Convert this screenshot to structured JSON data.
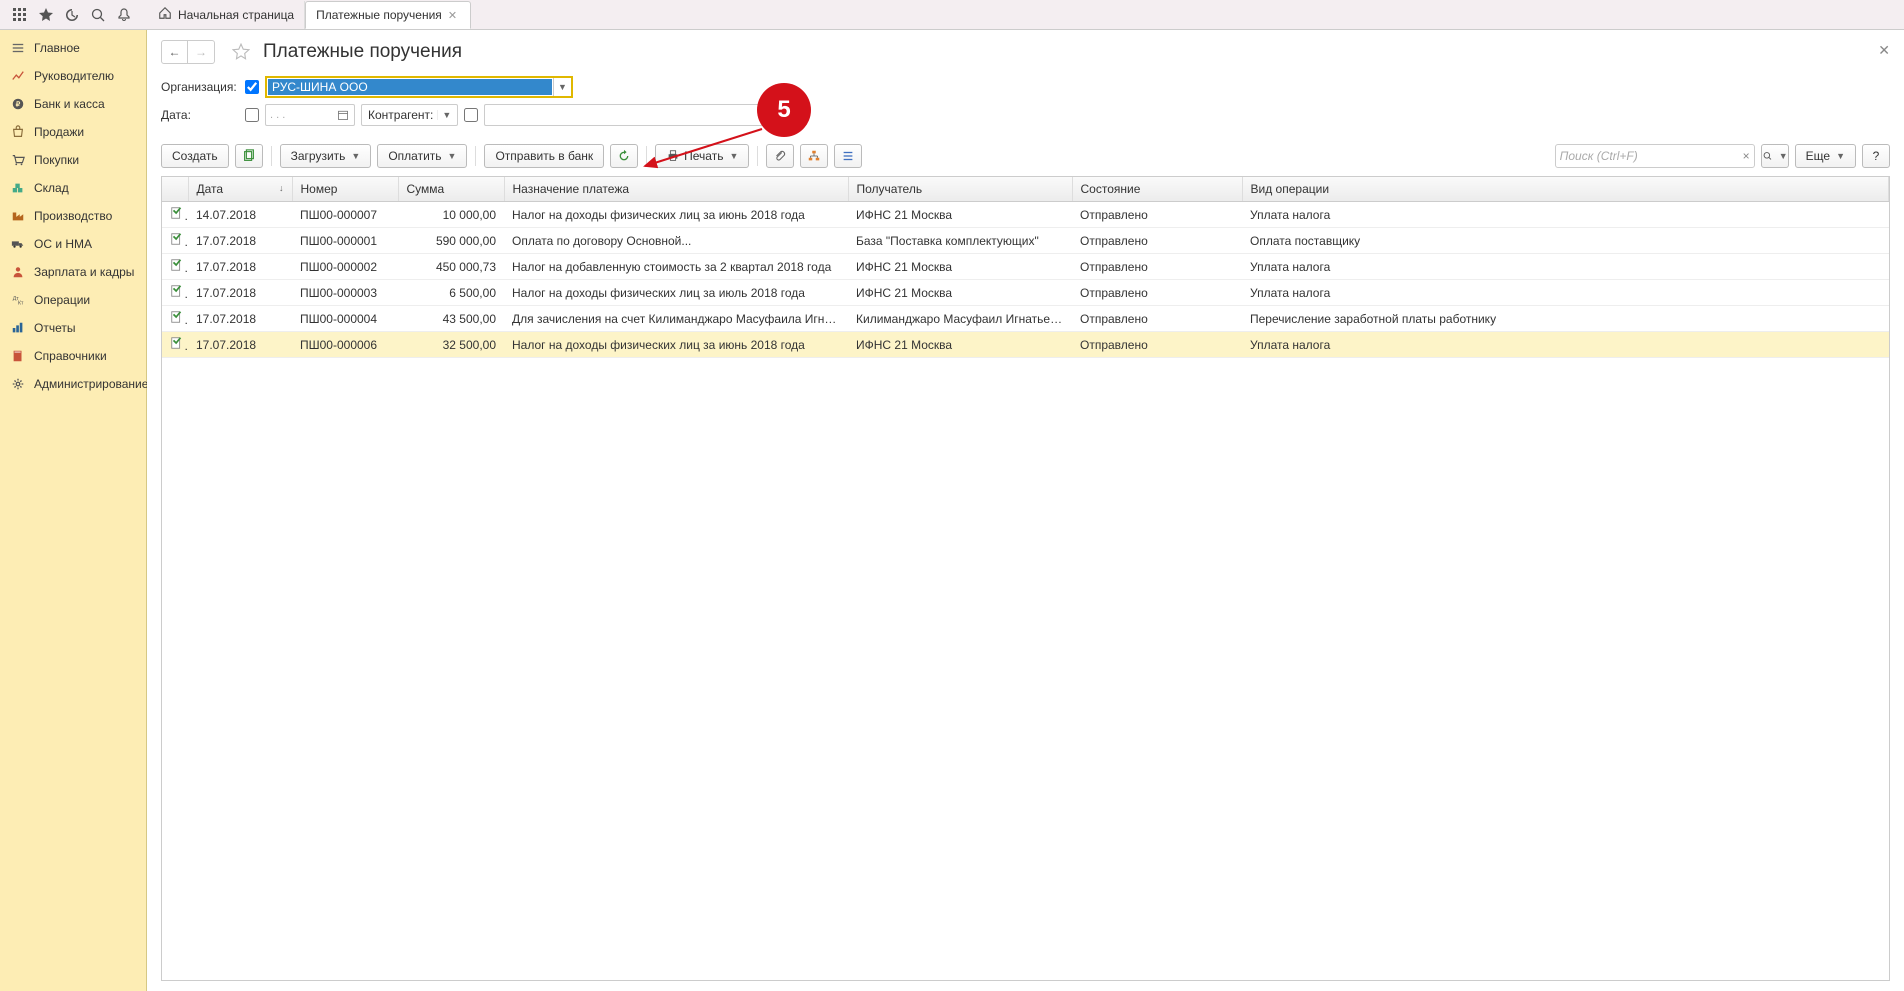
{
  "tabs": {
    "home": "Начальная страница",
    "active": "Платежные поручения"
  },
  "sidebar": {
    "items": [
      {
        "label": "Главное"
      },
      {
        "label": "Руководителю"
      },
      {
        "label": "Банк и касса"
      },
      {
        "label": "Продажи"
      },
      {
        "label": "Покупки"
      },
      {
        "label": "Склад"
      },
      {
        "label": "Производство"
      },
      {
        "label": "ОС и НМА"
      },
      {
        "label": "Зарплата и кадры"
      },
      {
        "label": "Операции"
      },
      {
        "label": "Отчеты"
      },
      {
        "label": "Справочники"
      },
      {
        "label": "Администрирование"
      }
    ]
  },
  "page": {
    "title": "Платежные поручения"
  },
  "filters": {
    "org_label": "Организация:",
    "org_value": "РУС-ШИНА ООО",
    "date_label": "Дата:",
    "date_placeholder": ". .   .",
    "kontragent_label": "Контрагент:"
  },
  "toolbar": {
    "create": "Создать",
    "load": "Загрузить",
    "pay": "Оплатить",
    "send_bank": "Отправить в банк",
    "print": "Печать",
    "search_placeholder": "Поиск (Ctrl+F)",
    "more": "Еще"
  },
  "table": {
    "headers": {
      "date": "Дата",
      "number": "Номер",
      "amount": "Сумма",
      "purpose": "Назначение платежа",
      "recipient": "Получатель",
      "state": "Состояние",
      "type": "Вид операции"
    },
    "rows": [
      {
        "date": "14.07.2018",
        "number": "ПШ00-000007",
        "amount": "10 000,00",
        "purpose": "Налог на доходы физических лиц за июнь 2018 года",
        "recipient": "ИФНС 21 Москва",
        "state": "Отправлено",
        "type": "Уплата налога"
      },
      {
        "date": "17.07.2018",
        "number": "ПШ00-000001",
        "amount": "590 000,00",
        "purpose": "Оплата по договору Основной...",
        "recipient": "База \"Поставка комплектующих\"",
        "state": "Отправлено",
        "type": "Оплата поставщику"
      },
      {
        "date": "17.07.2018",
        "number": "ПШ00-000002",
        "amount": "450 000,73",
        "purpose": "Налог на добавленную стоимость за 2 квартал 2018 года",
        "recipient": "ИФНС 21 Москва",
        "state": "Отправлено",
        "type": "Уплата налога"
      },
      {
        "date": "17.07.2018",
        "number": "ПШ00-000003",
        "amount": "6 500,00",
        "purpose": "Налог на доходы физических лиц за июль 2018 года",
        "recipient": "ИФНС 21 Москва",
        "state": "Отправлено",
        "type": "Уплата налога"
      },
      {
        "date": "17.07.2018",
        "number": "ПШ00-000004",
        "amount": "43 500,00",
        "purpose": "Для зачисления на счет Килиманджаро Масуфаила Игнатьевич...",
        "recipient": "Килиманджаро Масуфаил Игнатьевич",
        "state": "Отправлено",
        "type": "Перечисление заработной платы работнику"
      },
      {
        "date": "17.07.2018",
        "number": "ПШ00-000006",
        "amount": "32 500,00",
        "purpose": "Налог на доходы физических лиц за июнь 2018 года",
        "recipient": "ИФНС 21 Москва",
        "state": "Отправлено",
        "type": "Уплата налога"
      }
    ]
  },
  "callout": {
    "number": "5"
  }
}
